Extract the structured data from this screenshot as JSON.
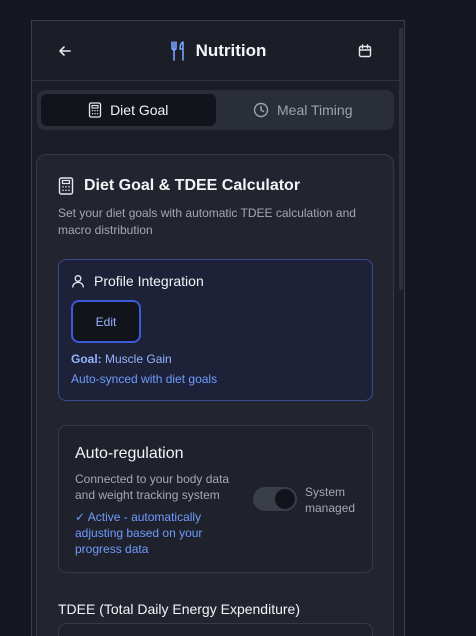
{
  "header": {
    "title": "Nutrition",
    "back_icon": "arrow-left-icon",
    "title_icon": "utensils-icon",
    "calendar_icon": "calendar-icon"
  },
  "tabs": [
    {
      "label": "Diet Goal",
      "icon": "calculator-icon",
      "active": true
    },
    {
      "label": "Meal Timing",
      "icon": "clock-icon",
      "active": false
    }
  ],
  "card": {
    "title": "Diet Goal & TDEE Calculator",
    "description": "Set your diet goals with automatic TDEE calculation and macro distribution",
    "profile": {
      "title": "Profile Integration",
      "edit_label": "Edit",
      "goal_key": "Goal:",
      "goal_value": "Muscle Gain",
      "synced_text": "Auto-synced with diet goals"
    },
    "autoregulation": {
      "title": "Auto-regulation",
      "description": "Connected to your body data and weight tracking system",
      "status": "✓ Active - automatically adjusting based on your progress data",
      "toggle_label": "System managed",
      "toggle_on": false
    },
    "tdee_label": "TDEE (Total Daily Energy Expenditure)"
  },
  "colors": {
    "accent": "#6e9bff",
    "accent_border": "#3b5bdb",
    "background": "#161821"
  }
}
